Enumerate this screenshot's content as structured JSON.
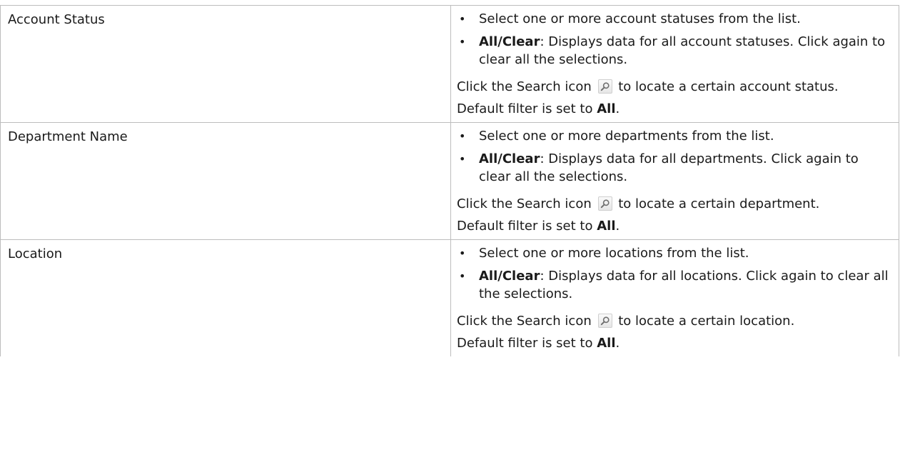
{
  "rows": [
    {
      "name": "Account Status",
      "options": [
        {
          "text": "Select one or more account statuses from the list."
        },
        {
          "strong": "All/Clear",
          "text": ": Displays data for all account statuses. Click again to clear all the selections."
        }
      ],
      "search_note": {
        "before": "Click the Search icon",
        "after": "to locate a certain account status."
      },
      "default_note": {
        "before": "Default filter is set to ",
        "value": "All",
        "after": "."
      }
    },
    {
      "name": "Department Name",
      "options": [
        {
          "text": "Select one or more departments from the list."
        },
        {
          "strong": "All/Clear",
          "text": ": Displays data for all departments. Click again to clear all the selections."
        }
      ],
      "search_note": {
        "before": "Click the Search icon",
        "after": "to locate a certain department."
      },
      "default_note": {
        "before": "Default filter is set to ",
        "value": "All",
        "after": "."
      }
    },
    {
      "name": "Location",
      "options": [
        {
          "text": "Select one or more locations from the list."
        },
        {
          "strong": "All/Clear",
          "text": ": Displays data for all locations. Click again to clear all the selections."
        }
      ],
      "search_note": {
        "before": "Click the Search icon",
        "after": "to locate a certain location."
      },
      "default_note": {
        "before": "Default filter is set to ",
        "value": "All",
        "after": "."
      }
    }
  ],
  "bullet_glyph": "•",
  "icons": {
    "search": "search-icon"
  },
  "colors": {
    "border": "#bdbdbd",
    "text": "#1a1a1a"
  }
}
